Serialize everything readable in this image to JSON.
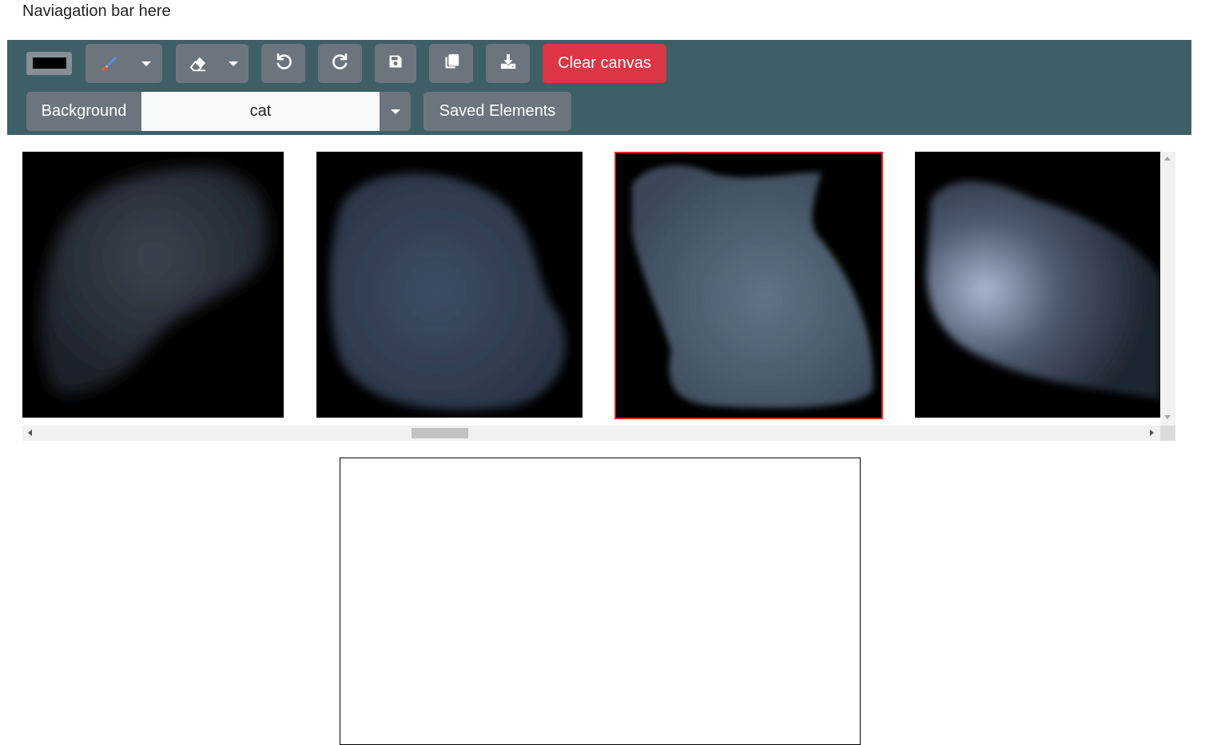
{
  "nav": {
    "text": "Naviagation bar here"
  },
  "toolbar": {
    "color_swatch": {
      "color": "#000000",
      "icon": "color-swatch"
    },
    "brush_button": {
      "icon": "paintbrush-icon"
    },
    "eraser_button": {
      "icon": "eraser-icon"
    },
    "undo_button": {
      "icon": "undo-icon"
    },
    "redo_button": {
      "icon": "redo-icon"
    },
    "save_button": {
      "icon": "floppy-disk-icon"
    },
    "copy_button": {
      "icon": "copy-icon"
    },
    "download_button": {
      "icon": "download-icon"
    },
    "clear_label": "Clear canvas",
    "background_label": "Background",
    "background_value": "cat",
    "saved_elements_label": "Saved Elements"
  },
  "gallery": {
    "selected_index": 2,
    "images": [
      {
        "name": "generated-image-1"
      },
      {
        "name": "generated-image-2"
      },
      {
        "name": "generated-image-3"
      },
      {
        "name": "generated-image-4"
      }
    ]
  },
  "colors": {
    "toolbar_bg": "#3e5f66",
    "button_gray": "#6c757d",
    "danger": "#dc3545",
    "selected_border": "#e02424"
  }
}
